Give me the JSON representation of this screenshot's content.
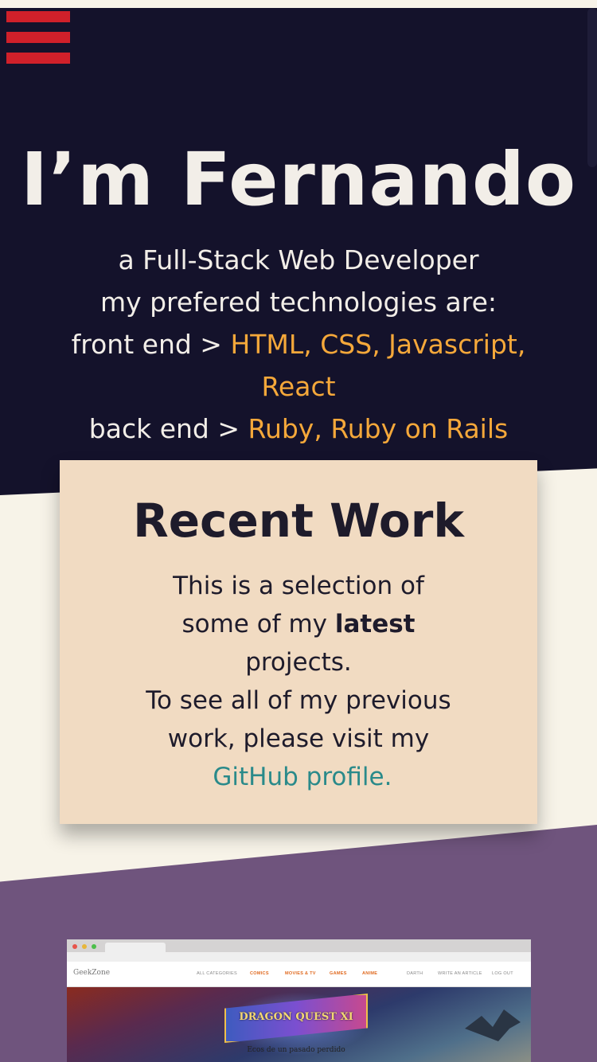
{
  "menu": {
    "icon": "hamburger-menu-icon",
    "color": "#d0202a"
  },
  "hero": {
    "title": "I’m Fernando",
    "line1": "a Full-Stack Web Developer",
    "line2": "my prefered technologies are:",
    "front_label": "front end > ",
    "front_value_1": "HTML, CSS, Javascript,",
    "front_value_2": "React",
    "back_label": "back end > ",
    "back_value": "Ruby, Ruby on Rails",
    "bg_color": "#14122b",
    "accent_color": "#f5a83a"
  },
  "recent_work": {
    "title": "Recent Work",
    "text_1": "This is a selection of some of my ",
    "text_bold": "latest",
    "text_2": " projects.",
    "text_3": "To see all of my previous work, please visit my ",
    "link_text": "GitHub profile.",
    "card_color": "#f1dbc2",
    "link_color": "#2a8a8a"
  },
  "project": {
    "site_logo": "GeekZone",
    "nav": [
      "ALL CATEGORIES",
      "COMICS",
      "MOVIES & TV",
      "GAMES",
      "ANIME",
      "DARTH",
      "WRITE AN ARTICLE",
      "LOG OUT"
    ],
    "art_title": "DRAGON QUEST XI",
    "art_subtitle": "Ecos de un pasado perdido"
  },
  "colors": {
    "purple_section": "#6f547d",
    "cream_bg": "#f7f3e8"
  }
}
